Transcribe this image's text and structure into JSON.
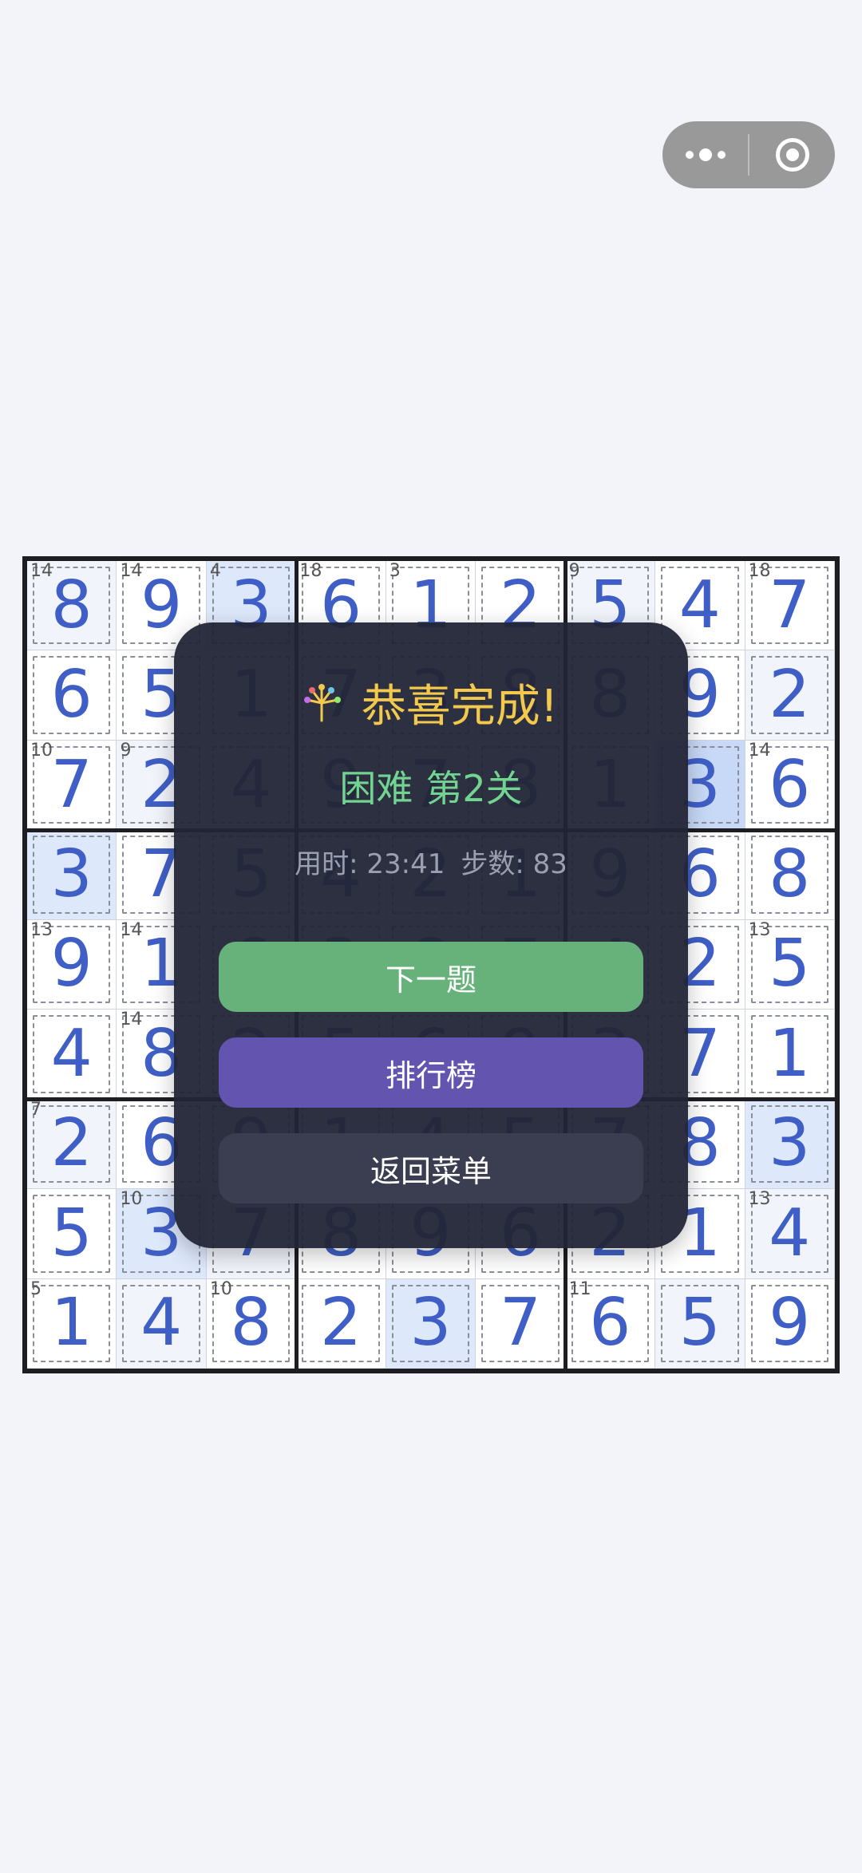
{
  "board": [
    [
      8,
      9,
      3,
      6,
      1,
      2,
      5,
      4,
      7
    ],
    [
      6,
      5,
      1,
      7,
      3,
      8,
      8,
      9,
      2
    ],
    [
      7,
      2,
      4,
      9,
      7,
      8,
      1,
      3,
      6
    ],
    [
      3,
      7,
      5,
      4,
      2,
      1,
      9,
      6,
      8
    ],
    [
      9,
      1,
      6,
      3,
      8,
      7,
      4,
      2,
      5
    ],
    [
      4,
      8,
      2,
      5,
      6,
      9,
      3,
      7,
      1
    ],
    [
      2,
      6,
      9,
      1,
      4,
      5,
      7,
      8,
      3
    ],
    [
      5,
      3,
      7,
      8,
      9,
      6,
      2,
      1,
      4
    ],
    [
      1,
      4,
      8,
      2,
      3,
      7,
      6,
      5,
      9
    ]
  ],
  "cage_sums": [
    {
      "r": 0,
      "c": 0,
      "sum": "14"
    },
    {
      "r": 0,
      "c": 1,
      "sum": "14"
    },
    {
      "r": 0,
      "c": 2,
      "sum": "4"
    },
    {
      "r": 0,
      "c": 3,
      "sum": "18"
    },
    {
      "r": 0,
      "c": 4,
      "sum": "3"
    },
    {
      "r": 0,
      "c": 6,
      "sum": "9"
    },
    {
      "r": 0,
      "c": 8,
      "sum": "18"
    },
    {
      "r": 2,
      "c": 0,
      "sum": "10"
    },
    {
      "r": 2,
      "c": 1,
      "sum": "9"
    },
    {
      "r": 2,
      "c": 8,
      "sum": "14"
    },
    {
      "r": 4,
      "c": 0,
      "sum": "13"
    },
    {
      "r": 4,
      "c": 1,
      "sum": "14"
    },
    {
      "r": 4,
      "c": 8,
      "sum": "13"
    },
    {
      "r": 5,
      "c": 1,
      "sum": "14"
    },
    {
      "r": 6,
      "c": 0,
      "sum": "7"
    },
    {
      "r": 7,
      "c": 1,
      "sum": "10"
    },
    {
      "r": 7,
      "c": 8,
      "sum": "13"
    },
    {
      "r": 8,
      "c": 0,
      "sum": "5"
    },
    {
      "r": 8,
      "c": 2,
      "sum": "10"
    },
    {
      "r": 8,
      "c": 6,
      "sum": "11"
    }
  ],
  "highlighted_cells": [
    {
      "r": 0,
      "c": 2,
      "level": "light"
    },
    {
      "r": 3,
      "c": 0,
      "level": "light"
    },
    {
      "r": 2,
      "c": 7,
      "level": "strong"
    },
    {
      "r": 6,
      "c": 8,
      "level": "light"
    },
    {
      "r": 7,
      "c": 1,
      "level": "light"
    },
    {
      "r": 8,
      "c": 4,
      "level": "light"
    }
  ],
  "colors": {
    "digit": "#3f5fc6",
    "highlight_light": "#dde8fb",
    "highlight_strong": "#c7d9f7",
    "region_tint": "#f1f4fb"
  },
  "dialog": {
    "icon": "sparkle-icon",
    "title": "恭喜完成!",
    "difficulty": "困难",
    "level": "第2关",
    "time_label": "用时: 23:41",
    "steps_label": "步数: 83",
    "next_button": "下一题",
    "leaderboard_button": "排行榜",
    "menu_button": "返回菜单"
  },
  "capsule": {
    "menu_icon": "more-dots-icon",
    "close_icon": "target-circle-icon"
  }
}
